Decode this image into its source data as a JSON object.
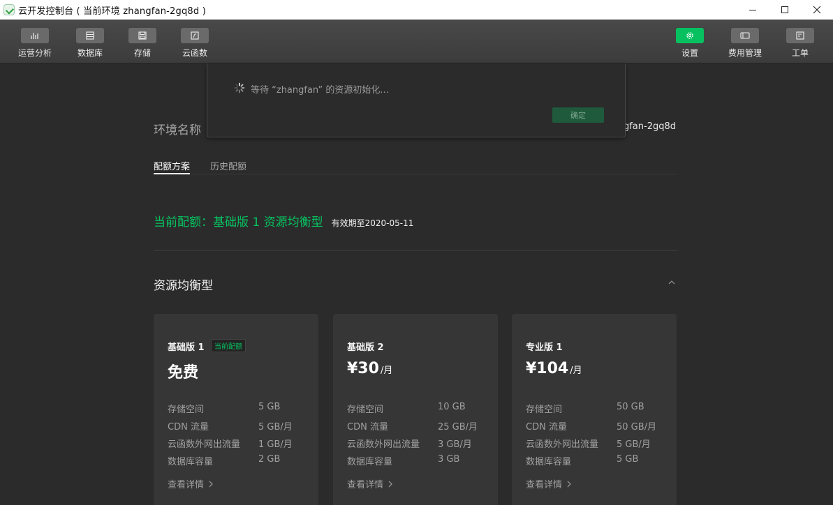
{
  "window": {
    "title": "云开发控制台 ( 当前环境 zhangfan-2gq8d )",
    "controls": [
      "minimize-icon",
      "maximize-icon",
      "close-icon"
    ]
  },
  "toolbar": {
    "left_items": [
      {
        "label": "运营分析",
        "icon": "bar-chart-icon"
      },
      {
        "label": "数据库",
        "icon": "database-icon"
      },
      {
        "label": "存储",
        "icon": "storage-icon"
      },
      {
        "label": "云函数",
        "icon": "cloud-function-icon"
      }
    ],
    "right_items": [
      {
        "label": "设置",
        "icon": "gear-icon",
        "active": true
      },
      {
        "label": "费用管理",
        "icon": "billing-icon"
      },
      {
        "label": "工单",
        "icon": "ticket-icon"
      }
    ],
    "accent_color": "#07c160"
  },
  "env": {
    "label": "环境名称",
    "value_visible": "ngfan-2gq8d"
  },
  "tabs": [
    {
      "label": "配额方案",
      "active": true
    },
    {
      "label": "历史配额",
      "active": false
    }
  ],
  "current_plan": {
    "text": "当前配额：基础版 1 资源均衡型",
    "expiry": "有效期至2020-05-11"
  },
  "section": {
    "title": "资源均衡型"
  },
  "cards": [
    {
      "name": "基础版 1",
      "badge": "当前配额",
      "price": "免费",
      "unit": "",
      "specs": [
        {
          "k": "存储空间",
          "v": "5 GB"
        },
        {
          "k": "CDN 流量",
          "v": "5 GB/月"
        },
        {
          "k": "云函数外网出流量",
          "v": "1 GB/月"
        },
        {
          "k": "数据库容量",
          "v": "2 GB"
        }
      ],
      "details": "查看详情"
    },
    {
      "name": "基础版 2",
      "badge": "",
      "price": "¥30",
      "unit": "/月",
      "specs": [
        {
          "k": "存储空间",
          "v": "10 GB"
        },
        {
          "k": "CDN 流量",
          "v": "25 GB/月"
        },
        {
          "k": "云函数外网出流量",
          "v": "3 GB/月"
        },
        {
          "k": "数据库容量",
          "v": "3 GB"
        }
      ],
      "details": "查看详情"
    },
    {
      "name": "专业版 1",
      "badge": "",
      "price": "¥104",
      "unit": "/月",
      "specs": [
        {
          "k": "存储空间",
          "v": "50 GB"
        },
        {
          "k": "CDN 流量",
          "v": "50 GB/月"
        },
        {
          "k": "云函数外网出流量",
          "v": "5 GB/月"
        },
        {
          "k": "数据库容量",
          "v": "5 GB"
        }
      ],
      "details": "查看详情"
    }
  ],
  "modal": {
    "message": "等待 “zhangfan” 的资源初始化...",
    "ok_label": "确定"
  }
}
